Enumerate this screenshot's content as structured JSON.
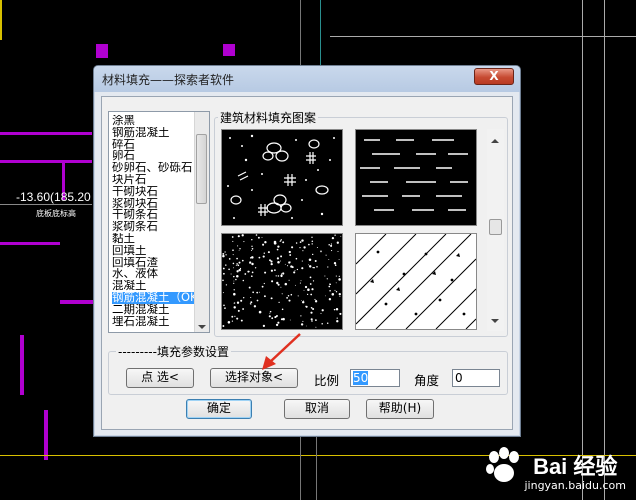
{
  "window": {
    "title": "材料填充——探索者软件",
    "close_label": "X"
  },
  "material_list": {
    "items": [
      "涂黑",
      "钢筋混凝土",
      "碎石",
      "卵石",
      "砂卵石、砂砾石",
      "块片石",
      "干砌块石",
      "浆砌块石",
      "干砌条石",
      "浆砌条石",
      "黏土",
      "回填土",
      "回填石渣",
      "水、液体",
      "混凝土",
      "钢筋混凝土（OK",
      "二期混凝土",
      "埋石混凝土"
    ],
    "selected_index": 15
  },
  "pattern_group": {
    "label": "建筑材料填充图案",
    "patterns": [
      "rubble-stone",
      "dashes",
      "gravel-dots",
      "diagonal-hatch"
    ]
  },
  "params_group": {
    "label": "---------填充参数设置",
    "pick_points_label": "点  选<",
    "select_objects_label": "选择对象<",
    "scale_label": "比例",
    "scale_value": "50",
    "angle_label": "角度",
    "angle_value": "0"
  },
  "buttons": {
    "ok": "确定",
    "cancel": "取消",
    "help": "帮助(H)"
  },
  "cad": {
    "elevation_text": "-13.60(185.20",
    "sub_text": "底板底标高"
  },
  "watermark": {
    "brand": "Bai 经验",
    "url": "jingyan.baidu.com"
  },
  "colors": {
    "accent_arrow": "#e03020",
    "selection": "#3399ff",
    "cad_magenta": "#b000d0"
  }
}
